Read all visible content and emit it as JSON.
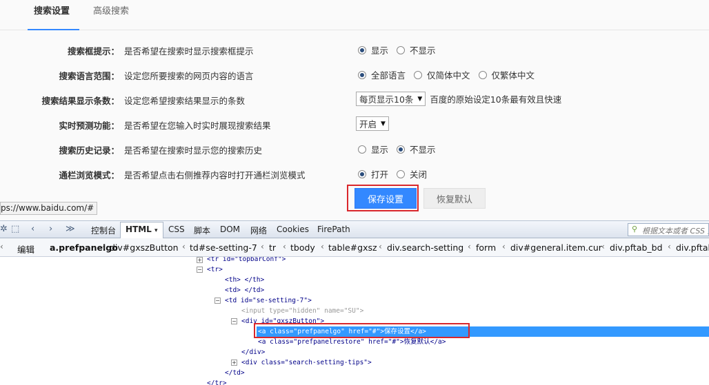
{
  "tabs": [
    {
      "label": "搜索设置",
      "active": true
    },
    {
      "label": "高级搜索",
      "active": false
    }
  ],
  "settings": [
    {
      "label": "搜索框提示：",
      "desc": "是否希望在搜索时显示搜索框提示",
      "options": [
        "显示",
        "不显示"
      ],
      "selected": 0
    },
    {
      "label": "搜索语言范围：",
      "desc": "设定您所要搜索的网页内容的语言",
      "options": [
        "全部语言",
        "仅简体中文",
        "仅繁体中文"
      ],
      "selected": 0
    },
    {
      "label": "搜索结果显示条数：",
      "desc": "设定您希望搜索结果显示的条数",
      "select": "每页显示10条",
      "hint": "百度的原始设定10条最有效且快速"
    },
    {
      "label": "实时预测功能：",
      "desc": "是否希望在您输入时实时展现搜索结果",
      "select": "开启"
    },
    {
      "label": "搜索历史记录：",
      "desc": "是否希望在搜索时显示您的搜索历史",
      "options": [
        "显示",
        "不显示"
      ],
      "selected": 1
    },
    {
      "label": "通栏浏览模式：",
      "desc": "是否希望点击右侧推荐内容时打开通栏浏览模式",
      "options": [
        "打开",
        "关闭"
      ],
      "selected": 0
    }
  ],
  "buttons": {
    "save": "保存设置",
    "restore": "恢复默认"
  },
  "status_url": "ps://www.baidu.com/#",
  "firebug": {
    "tabs": [
      "控制台",
      "HTML",
      "CSS",
      "脚本",
      "DOM",
      "网络",
      "Cookies",
      "FirePath"
    ],
    "active_tab": "HTML",
    "search_placeholder": "根据文本或者 CSS 选",
    "edit_label": "编辑",
    "breadcrumbs": [
      "a.prefpanelgo",
      "div#gxszButton",
      "td#se-setting-7",
      "tr",
      "tbody",
      "table#gxsz",
      "div.search-setting",
      "form",
      "div#general.item.cur",
      "div.pftab_bd",
      "div.pftab"
    ],
    "tree": [
      "<tr id=\"topbarConf\">",
      "<tr>",
      "<th> </th>",
      "<td> </td>",
      "<td id=\"se-setting-7\">",
      "<input type=\"hidden\" name=\"SU\">",
      "<div id=\"gxszButton\">",
      "<a class=\"prefpanelgo\" href=\"#\">保存设置</a>",
      "<a class=\"prefpanelrestore\" href=\"#\">恢复默认</a>",
      "</div>",
      "<div class=\"search-setting-tips\">",
      "</td>",
      "</tr>"
    ]
  },
  "colors": {
    "accent": "#3388ff",
    "highlight": "#d9262b",
    "selection": "#3399ff"
  }
}
